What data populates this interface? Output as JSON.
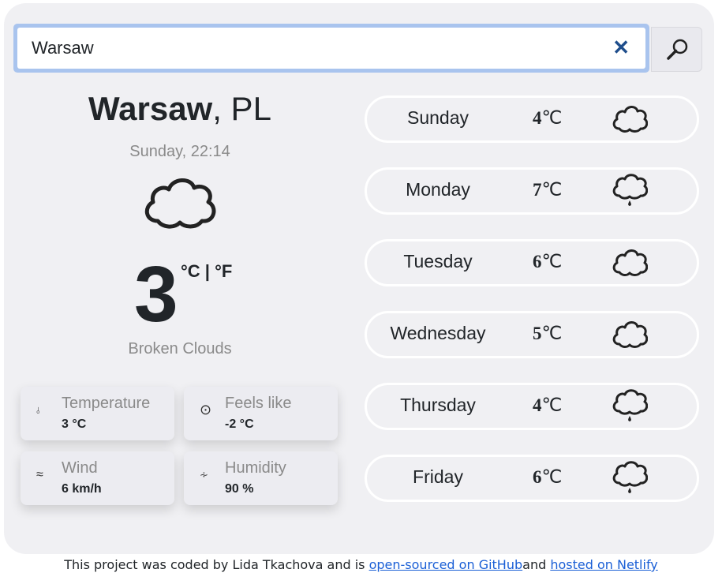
{
  "search": {
    "value": "Warsaw",
    "clear_icon": "close-icon",
    "button_icon": "magnifier-icon"
  },
  "current": {
    "city": "Warsaw",
    "country": ", PL",
    "datetime": "Sunday, 22:14",
    "icon": "cloud-icon",
    "temperature": "3",
    "units": "°C | °F",
    "description": "Broken Clouds"
  },
  "details": [
    {
      "icon": "thermometer-icon",
      "glyph": "🌡",
      "label": "Temperature",
      "value": "3 °C"
    },
    {
      "icon": "feels-like-icon",
      "glyph": "⊙",
      "label": "Feels like",
      "value": "-2 °C"
    },
    {
      "icon": "wind-icon",
      "glyph": "≋",
      "label": "Wind",
      "value": "6 km/h"
    },
    {
      "icon": "humidity-icon",
      "glyph": "⍨",
      "label": "Humidity",
      "value": "90 %"
    }
  ],
  "forecast": [
    {
      "day": "Sunday",
      "temp": "4",
      "unit": "℃",
      "icon": "cloud-icon"
    },
    {
      "day": "Monday",
      "temp": "7",
      "unit": "℃",
      "icon": "rain-cloud-icon"
    },
    {
      "day": "Tuesday",
      "temp": "6",
      "unit": "℃",
      "icon": "cloud-icon"
    },
    {
      "day": "Wednesday",
      "temp": "5",
      "unit": "℃",
      "icon": "cloud-icon"
    },
    {
      "day": "Thursday",
      "temp": "4",
      "unit": "℃",
      "icon": "rain-cloud-icon"
    },
    {
      "day": "Friday",
      "temp": "6",
      "unit": "℃",
      "icon": "rain-cloud-icon"
    }
  ],
  "footer": {
    "text_before": "This project was coded by Lida Tkachova and is ",
    "link_github": "open-sourced on GitHub",
    "text_middle": "and ",
    "link_netlify": "hosted on Netlify"
  },
  "colors": {
    "card_background": "#f0f0f3",
    "search_focus": "#a9c4ee",
    "link": "#1a5fd6",
    "clear_icon": "#1f4e8c"
  }
}
